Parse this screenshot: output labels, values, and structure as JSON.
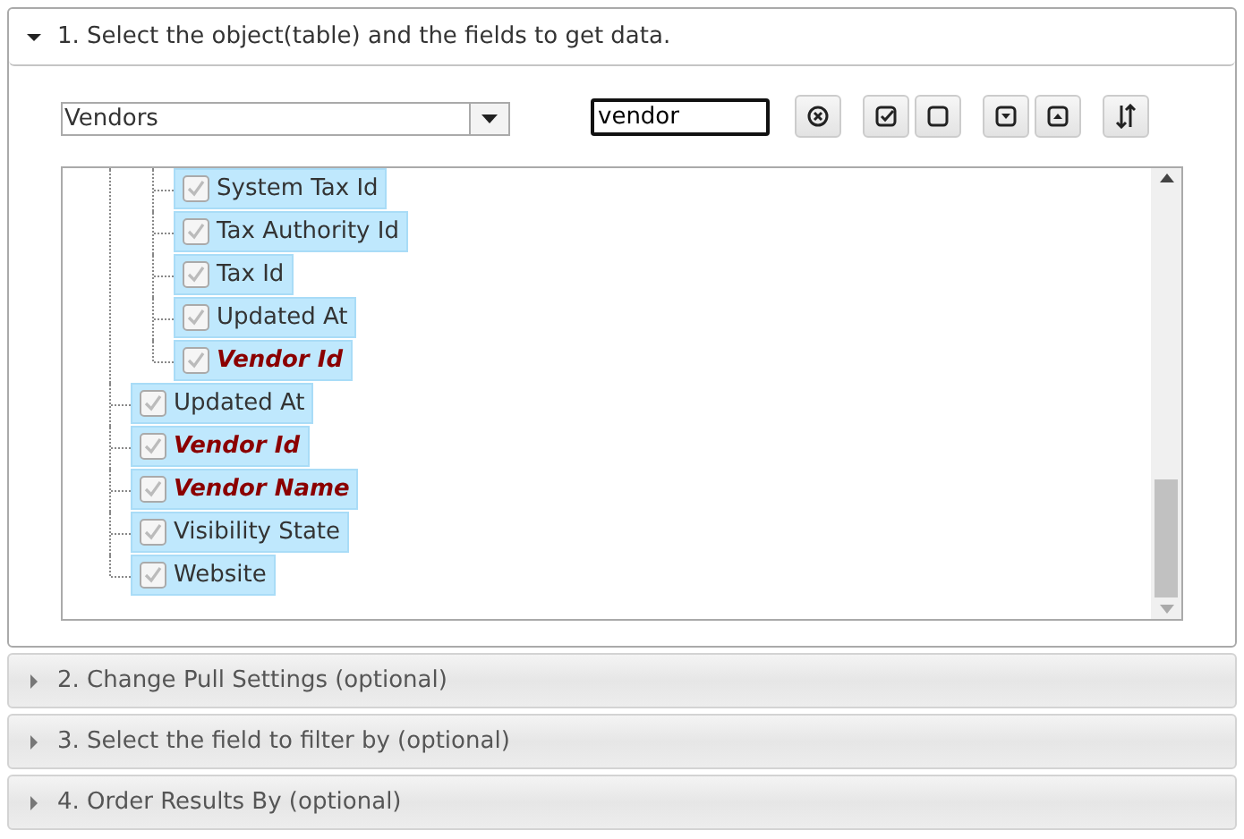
{
  "sections": [
    {
      "title": "1. Select the object(table) and the fields to get data.",
      "expanded": true
    },
    {
      "title": "2. Change Pull Settings (optional)",
      "expanded": false
    },
    {
      "title": "3. Select the field to filter by (optional)",
      "expanded": false
    },
    {
      "title": "4. Order Results By (optional)",
      "expanded": false
    }
  ],
  "selector": {
    "object": "Vendors",
    "search": "vendor",
    "tree": [
      {
        "children": [
          {
            "label": "System Tax Id",
            "checked": true,
            "selected": true,
            "emphasized": false
          },
          {
            "label": "Tax Authority Id",
            "checked": true,
            "selected": true,
            "emphasized": false
          },
          {
            "label": "Tax Id",
            "checked": true,
            "selected": true,
            "emphasized": false
          },
          {
            "label": "Updated At",
            "checked": true,
            "selected": true,
            "emphasized": false
          },
          {
            "label": "Vendor Id",
            "checked": true,
            "selected": true,
            "emphasized": true
          }
        ]
      },
      {
        "label": "Updated At",
        "checked": true,
        "selected": true,
        "emphasized": false
      },
      {
        "label": "Vendor Id",
        "checked": true,
        "selected": true,
        "emphasized": true
      },
      {
        "label": "Vendor Name",
        "checked": true,
        "selected": true,
        "emphasized": true
      },
      {
        "label": "Visibility State",
        "checked": true,
        "selected": true,
        "emphasized": false
      },
      {
        "label": "Website",
        "checked": true,
        "selected": true,
        "emphasized": false
      }
    ]
  }
}
